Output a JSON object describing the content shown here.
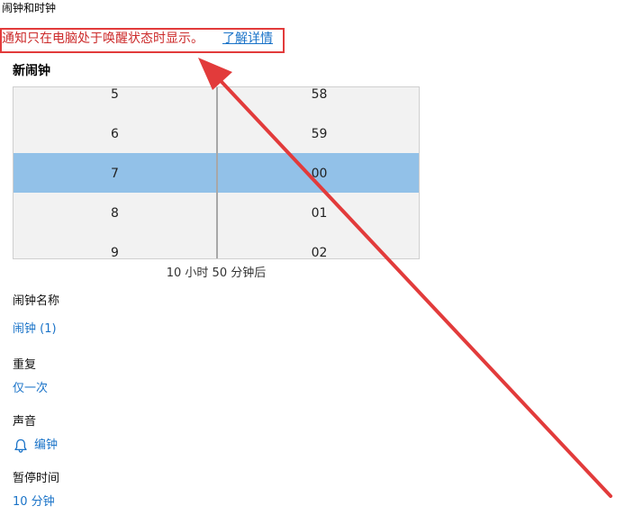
{
  "app": {
    "title": "闹钟和时钟"
  },
  "notice": {
    "text": "通知只在电脑处于唤醒状态时显示。",
    "link_label": "了解详情"
  },
  "new_alarm": {
    "title": "新闹钟",
    "hours": [
      "5",
      "6",
      "7",
      "8",
      "9"
    ],
    "minutes": [
      "58",
      "59",
      "00",
      "01",
      "02"
    ],
    "selected_hour": "7",
    "selected_minute": "00",
    "countdown": "10 小时 50 分钟后"
  },
  "fields": {
    "name_label": "闹钟名称",
    "name_value": "闹钟 (1)",
    "repeat_label": "重复",
    "repeat_value": "仅一次",
    "sound_label": "声音",
    "sound_value": "编钟",
    "snooze_label": "暂停时间",
    "snooze_value": "10 分钟"
  },
  "colors": {
    "highlight": "#92c1e8",
    "link": "#1a73c8",
    "annotation": "#e23b3b"
  },
  "icons": {
    "sound": "bell-icon"
  }
}
